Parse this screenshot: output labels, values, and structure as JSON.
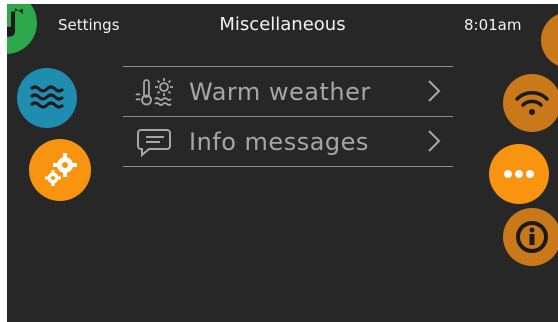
{
  "header": {
    "left_label": "Settings",
    "title": "Miscellaneous",
    "time": "8:01am"
  },
  "left_nav": [
    {
      "name": "music",
      "icon": "music-note-icon",
      "color": "#2aa84a"
    },
    {
      "name": "water",
      "icon": "water-waves-icon",
      "color": "#1e8db0"
    },
    {
      "name": "settings",
      "icon": "gears-icon",
      "color": "#f99411",
      "active": true
    }
  ],
  "right_nav": [
    {
      "name": "top",
      "color": "#c9781a"
    },
    {
      "name": "wifi",
      "icon": "wifi-icon",
      "color": "#c9781a"
    },
    {
      "name": "more",
      "icon": "ellipsis-icon",
      "color": "#f99411",
      "active": true
    },
    {
      "name": "info",
      "icon": "info-icon",
      "color": "#c9781a"
    }
  ],
  "menu": {
    "items": [
      {
        "label": "Warm weather",
        "icon": "thermometer-sun-icon"
      },
      {
        "label": "Info messages",
        "icon": "message-bubble-icon"
      }
    ]
  },
  "colors": {
    "background": "#272727",
    "text": "#f2f2f2",
    "menu_text": "#a6a6a6",
    "divider": "#8c8c8c"
  }
}
